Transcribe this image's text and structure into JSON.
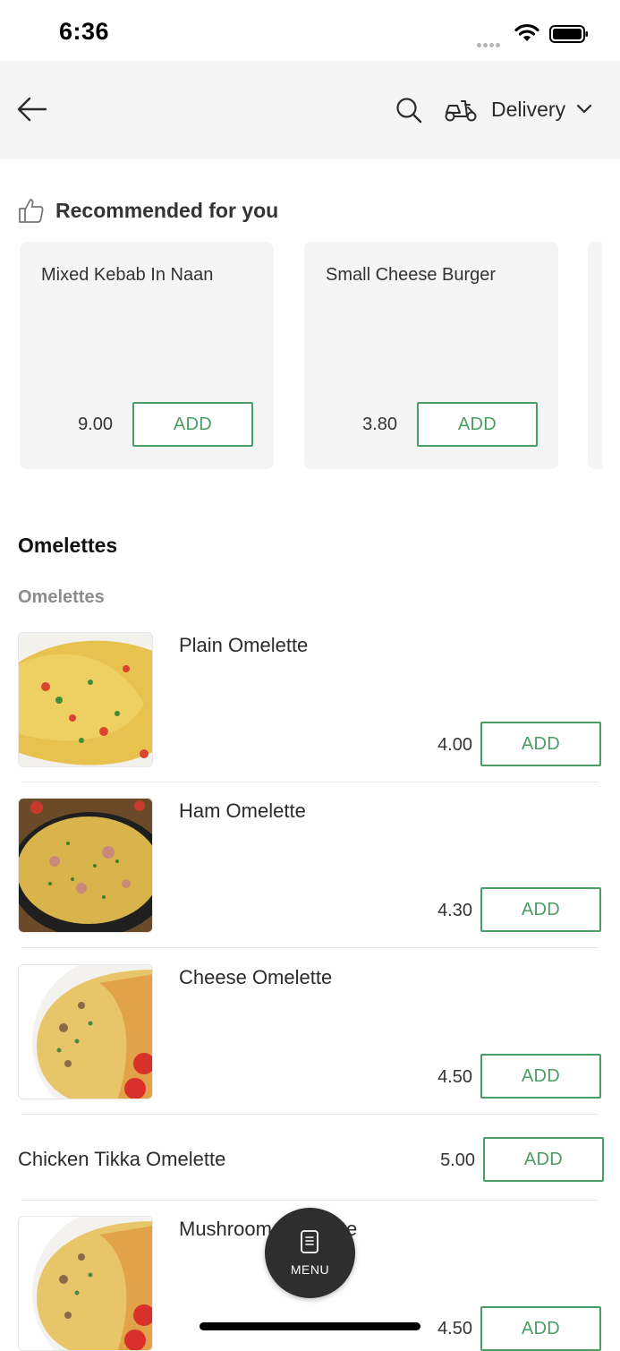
{
  "status_bar": {
    "time": "6:36"
  },
  "header": {
    "delivery_label": "Delivery"
  },
  "recommended": {
    "title": "Recommended for you",
    "items": [
      {
        "name": "Mixed Kebab In Naan",
        "price": "9.00",
        "add_label": "ADD"
      },
      {
        "name": "Small Cheese Burger",
        "price": "3.80",
        "add_label": "ADD"
      }
    ]
  },
  "section": {
    "title": "Omelettes",
    "subtitle": "Omelettes",
    "items": [
      {
        "name": "Plain Omelette",
        "price": "4.00",
        "add_label": "ADD"
      },
      {
        "name": "Ham Omelette",
        "price": "4.30",
        "add_label": "ADD"
      },
      {
        "name": "Cheese Omelette",
        "price": "4.50",
        "add_label": "ADD"
      },
      {
        "name": "Chicken Tikka Omelette",
        "price": "5.00",
        "add_label": "ADD"
      },
      {
        "name": "Mushroom Omelette",
        "price": "4.50",
        "add_label": "ADD"
      }
    ]
  },
  "menu_fab": {
    "label": "MENU"
  },
  "colors": {
    "accent": "#4a9e63",
    "header_bg": "#f5f5f5",
    "fab_bg": "#2e2e2e"
  }
}
